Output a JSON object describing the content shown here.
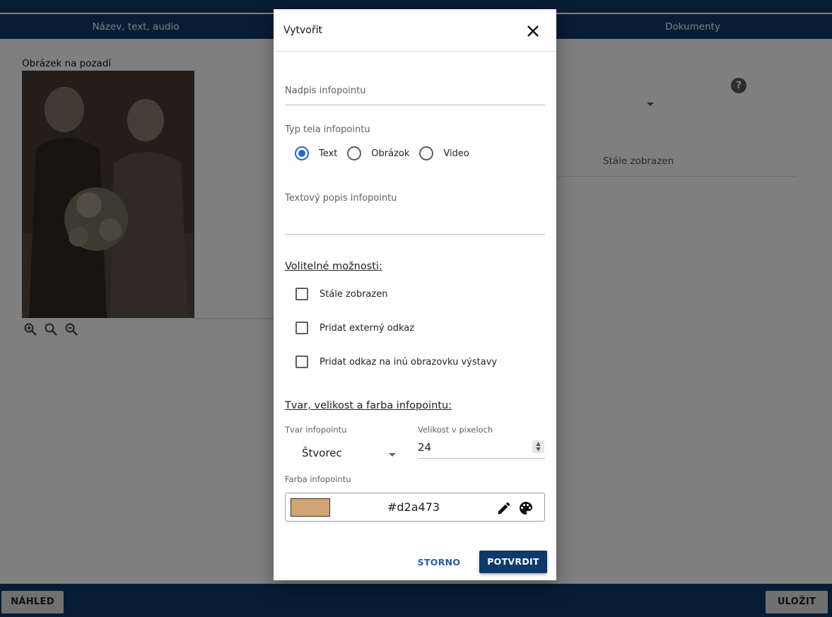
{
  "header": {
    "tabs": [
      {
        "label": "Název, text, audio"
      },
      {
        "label": "Dokumenty"
      }
    ]
  },
  "background": {
    "image_label": "Obrázek na pozadí",
    "help_label": "?",
    "column_header": "Stále zobrazen"
  },
  "footer": {
    "preview_label": "NÁHLED",
    "save_label": "ULOŽIT"
  },
  "dialog": {
    "title": "Vytvořit",
    "heading_label": "Nadpis infopointu",
    "body_type_label": "Typ tela infopointu",
    "body_types": [
      {
        "label": "Text",
        "selected": true
      },
      {
        "label": "Obrázok",
        "selected": false
      },
      {
        "label": "Video",
        "selected": false
      }
    ],
    "description_label": "Textový popis infopointu",
    "optional_title": "Volitelné možnosti:",
    "options": [
      {
        "label": "Stále zobrazen",
        "checked": false
      },
      {
        "label": "Pridat externý odkaz",
        "checked": false
      },
      {
        "label": "Pridat odkaz na inú obrazovku výstavy",
        "checked": false
      }
    ],
    "shape_section_title": "Tvar, velikost a farba infopointu:",
    "shape_label": "Tvar infopointu",
    "shape_value": "Štvorec",
    "size_label": "Velikost v pixeloch",
    "size_value": "24",
    "color_label": "Farba infopointu",
    "color_value": "#d2a473",
    "cancel_label": "STORNO",
    "confirm_label": "POTVRDIT"
  },
  "colors": {
    "brand": "#0d3a6b",
    "accent": "#1e6bd6",
    "swatch": "#d2a473"
  }
}
